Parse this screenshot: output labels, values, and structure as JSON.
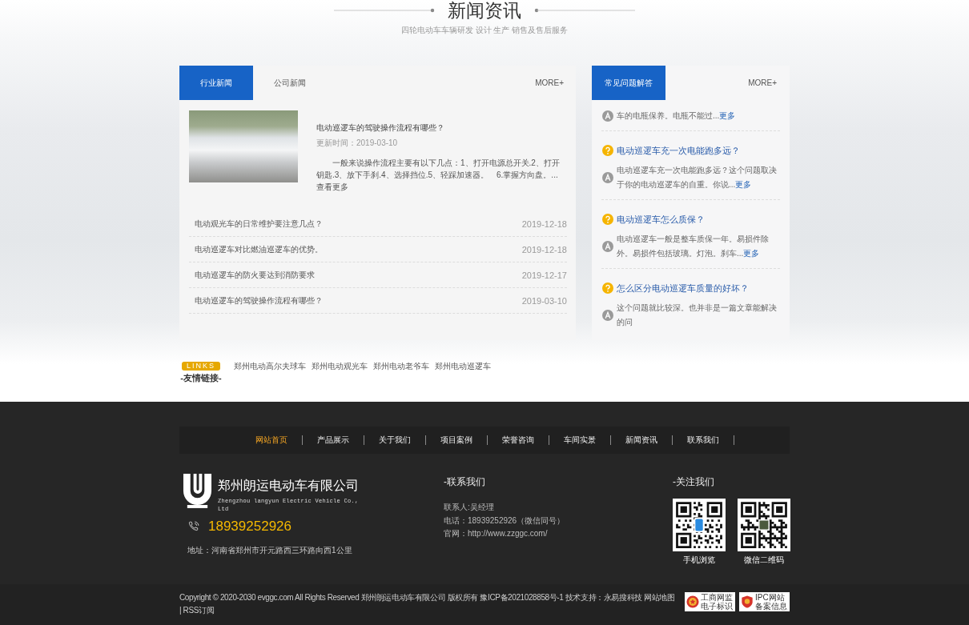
{
  "header": {
    "title": "新闻资讯",
    "subtitle": "四轮电动车车辆研发 设计 生产 销售及售后服务"
  },
  "news": {
    "tabs": [
      {
        "label": "行业新闻",
        "selected": true
      },
      {
        "label": "公司新闻",
        "selected": false
      }
    ],
    "more": "MORE+",
    "featured": {
      "title": "电动巡逻车的驾驶操作流程有哪些？",
      "date": "更新时间：2019-03-10",
      "summary": "一般来说操作流程主要有以下几点：1、打开电源总开关.2、打开钥匙.3、放下手刹.4、选择挡位.5、轻踩加速器。　6.掌握方向盘。...查看更多"
    },
    "items": [
      {
        "title": "电动观光车的日常维护要注意几点？",
        "date": "2019-12-18"
      },
      {
        "title": "电动巡逻车对比燃油巡逻车的优势。",
        "date": "2019-12-18"
      },
      {
        "title": "电动巡逻车的防火要达到消防要求",
        "date": "2019-12-17"
      },
      {
        "title": "电动巡逻车的驾驶操作流程有哪些？",
        "date": "2019-03-10"
      }
    ]
  },
  "faq": {
    "tabs": [
      {
        "label": "常见问题解答",
        "selected": true
      }
    ],
    "more": "MORE+",
    "items": [
      {
        "answer": "车的电瓶保养。电瓶不能过...",
        "more": "更多"
      },
      {
        "question": "电动巡逻车充一次电能跑多远？",
        "answer": "电动巡逻车充一次电能跑多远？这个问题取决于你的电动巡逻车的自重。你说...",
        "more": "更多"
      },
      {
        "question": "电动巡逻车怎么质保？",
        "answer": "电动巡逻车一般是整车质保一年。易损件除外。易损件包括玻璃。灯泡。刹车...",
        "more": "更多"
      },
      {
        "question": "怎么区分电动巡逻车质量的好坏？",
        "answer": "这个问题就比较深。也并非是一篇文章能解决的问"
      }
    ]
  },
  "links": {
    "badge": "LINKS",
    "title": "-友情链接-",
    "items": [
      "郑州电动高尔夫球车",
      "郑州电动观光车",
      "郑州电动老爷车",
      "郑州电动巡逻车"
    ]
  },
  "footer": {
    "nav": [
      {
        "label": "网站首页",
        "selected": true
      },
      {
        "label": "产品展示",
        "selected": false
      },
      {
        "label": "关于我们",
        "selected": false
      },
      {
        "label": "项目案例",
        "selected": false
      },
      {
        "label": "荣誉咨询",
        "selected": false
      },
      {
        "label": "车间实景",
        "selected": false
      },
      {
        "label": "新闻资讯",
        "selected": false
      },
      {
        "label": "联系我们",
        "selected": false
      }
    ],
    "company": {
      "name": "郑州朗运电动车有限公司",
      "name_en": "Zhengzhou langyun Electric Vehicle Co., Ltd",
      "phone": "18939252926",
      "address": "地址：河南省郑州市开元路西三环路向西1公里"
    },
    "contact": {
      "title": "-联系我们",
      "lines": [
        "联系人:吴经理",
        "电话：18939252926（微信同号）",
        "官网：http://www.zzggc.com/"
      ]
    },
    "follow": {
      "title": "-关注我们",
      "qr_codes": [
        {
          "kind": "mobile",
          "caption": "手机浏览"
        },
        {
          "kind": "wechat",
          "caption": "微信二维码"
        }
      ]
    },
    "copyright": "Copyright © 2020-2030 evggc.com All Rights Reserved 郑州朗运电动车有限公司 版权所有 豫ICP备2021028858号-1 技术支持：永易搜科技 网站地图 | RSS订阅",
    "badges": [
      {
        "kind": "commerce",
        "lines": [
          "工商网监",
          "电子标识"
        ]
      },
      {
        "kind": "icp",
        "lines": [
          "IPC网站",
          "备案信息"
        ]
      }
    ]
  }
}
